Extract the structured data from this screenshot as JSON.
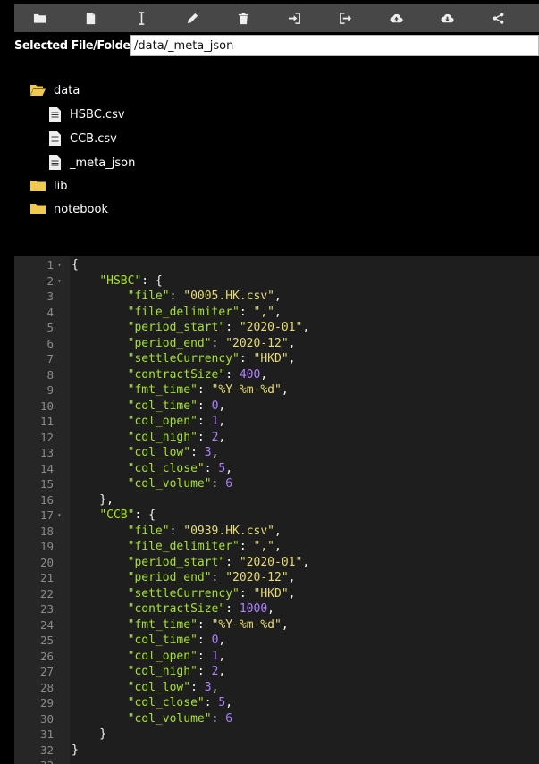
{
  "toolbar": {
    "buttons": [
      {
        "name": "open-folder-button",
        "icon": "folder-icon"
      },
      {
        "name": "new-file-button",
        "icon": "file-icon"
      },
      {
        "name": "rename-button",
        "icon": "text-cursor-icon"
      },
      {
        "name": "edit-button",
        "icon": "pencil-icon"
      },
      {
        "name": "delete-button",
        "icon": "trash-icon"
      },
      {
        "name": "sign-in-button",
        "icon": "sign-in-icon"
      },
      {
        "name": "sign-out-button",
        "icon": "sign-out-icon"
      },
      {
        "name": "upload-button",
        "icon": "cloud-upload-icon"
      },
      {
        "name": "download-button",
        "icon": "cloud-download-icon"
      },
      {
        "name": "share-button",
        "icon": "share-icon"
      }
    ],
    "background": "#474747"
  },
  "selection": {
    "label": "Selected File/Folder:",
    "value": "/data/_meta_json"
  },
  "tree": {
    "items": [
      {
        "label": "data",
        "type": "folder-open"
      },
      {
        "label": "HSBC.csv",
        "type": "file"
      },
      {
        "label": "CCB.csv",
        "type": "file"
      },
      {
        "label": "_meta_json",
        "type": "file"
      },
      {
        "label": "lib",
        "type": "folder"
      },
      {
        "label": "notebook",
        "type": "folder"
      }
    ],
    "folder_color": "#f0c94f"
  },
  "editor": {
    "lines": [
      {
        "n": "1",
        "fold": true,
        "t": [
          [
            "punc",
            "{"
          ]
        ]
      },
      {
        "n": "2",
        "fold": true,
        "t": [
          [
            "punc",
            "    "
          ],
          [
            "key",
            "\"HSBC\""
          ],
          [
            "punc",
            ": {"
          ]
        ]
      },
      {
        "n": "3",
        "t": [
          [
            "punc",
            "        "
          ],
          [
            "key",
            "\"file\""
          ],
          [
            "punc",
            ": "
          ],
          [
            "str",
            "\"0005.HK.csv\""
          ],
          [
            "punc",
            ","
          ]
        ]
      },
      {
        "n": "4",
        "t": [
          [
            "punc",
            "        "
          ],
          [
            "key",
            "\"file_delimiter\""
          ],
          [
            "punc",
            ": "
          ],
          [
            "str",
            "\",\""
          ],
          [
            "punc",
            ","
          ]
        ]
      },
      {
        "n": "5",
        "t": [
          [
            "punc",
            "        "
          ],
          [
            "key",
            "\"period_start\""
          ],
          [
            "punc",
            ": "
          ],
          [
            "str",
            "\"2020-01\""
          ],
          [
            "punc",
            ","
          ]
        ]
      },
      {
        "n": "6",
        "t": [
          [
            "punc",
            "        "
          ],
          [
            "key",
            "\"period_end\""
          ],
          [
            "punc",
            ": "
          ],
          [
            "str",
            "\"2020-12\""
          ],
          [
            "punc",
            ","
          ]
        ]
      },
      {
        "n": "7",
        "t": [
          [
            "punc",
            "        "
          ],
          [
            "key",
            "\"settleCurrency\""
          ],
          [
            "punc",
            ": "
          ],
          [
            "str",
            "\"HKD\""
          ],
          [
            "punc",
            ","
          ]
        ]
      },
      {
        "n": "8",
        "t": [
          [
            "punc",
            "        "
          ],
          [
            "key",
            "\"contractSize\""
          ],
          [
            "punc",
            ": "
          ],
          [
            "num",
            "400"
          ],
          [
            "punc",
            ","
          ]
        ]
      },
      {
        "n": "9",
        "t": [
          [
            "punc",
            "        "
          ],
          [
            "key",
            "\"fmt_time\""
          ],
          [
            "punc",
            ": "
          ],
          [
            "str",
            "\"%Y-%m-%d\""
          ],
          [
            "punc",
            ","
          ]
        ]
      },
      {
        "n": "10",
        "t": [
          [
            "punc",
            "        "
          ],
          [
            "key",
            "\"col_time\""
          ],
          [
            "punc",
            ": "
          ],
          [
            "num",
            "0"
          ],
          [
            "punc",
            ","
          ]
        ]
      },
      {
        "n": "11",
        "t": [
          [
            "punc",
            "        "
          ],
          [
            "key",
            "\"col_open\""
          ],
          [
            "punc",
            ": "
          ],
          [
            "num",
            "1"
          ],
          [
            "punc",
            ","
          ]
        ]
      },
      {
        "n": "12",
        "t": [
          [
            "punc",
            "        "
          ],
          [
            "key",
            "\"col_high\""
          ],
          [
            "punc",
            ": "
          ],
          [
            "num",
            "2"
          ],
          [
            "punc",
            ","
          ]
        ]
      },
      {
        "n": "13",
        "t": [
          [
            "punc",
            "        "
          ],
          [
            "key",
            "\"col_low\""
          ],
          [
            "punc",
            ": "
          ],
          [
            "num",
            "3"
          ],
          [
            "punc",
            ","
          ]
        ]
      },
      {
        "n": "14",
        "t": [
          [
            "punc",
            "        "
          ],
          [
            "key",
            "\"col_close\""
          ],
          [
            "punc",
            ": "
          ],
          [
            "num",
            "5"
          ],
          [
            "punc",
            ","
          ]
        ]
      },
      {
        "n": "15",
        "t": [
          [
            "punc",
            "        "
          ],
          [
            "key",
            "\"col_volume\""
          ],
          [
            "punc",
            ": "
          ],
          [
            "num",
            "6"
          ]
        ]
      },
      {
        "n": "16",
        "t": [
          [
            "punc",
            "    },"
          ]
        ]
      },
      {
        "n": "17",
        "fold": true,
        "t": [
          [
            "punc",
            "    "
          ],
          [
            "key",
            "\"CCB\""
          ],
          [
            "punc",
            ": {"
          ]
        ]
      },
      {
        "n": "18",
        "t": [
          [
            "punc",
            "        "
          ],
          [
            "key",
            "\"file\""
          ],
          [
            "punc",
            ": "
          ],
          [
            "str",
            "\"0939.HK.csv\""
          ],
          [
            "punc",
            ","
          ]
        ]
      },
      {
        "n": "19",
        "t": [
          [
            "punc",
            "        "
          ],
          [
            "key",
            "\"file_delimiter\""
          ],
          [
            "punc",
            ": "
          ],
          [
            "str",
            "\",\""
          ],
          [
            "punc",
            ","
          ]
        ]
      },
      {
        "n": "20",
        "t": [
          [
            "punc",
            "        "
          ],
          [
            "key",
            "\"period_start\""
          ],
          [
            "punc",
            ": "
          ],
          [
            "str",
            "\"2020-01\""
          ],
          [
            "punc",
            ","
          ]
        ]
      },
      {
        "n": "21",
        "t": [
          [
            "punc",
            "        "
          ],
          [
            "key",
            "\"period_end\""
          ],
          [
            "punc",
            ": "
          ],
          [
            "str",
            "\"2020-12\""
          ],
          [
            "punc",
            ","
          ]
        ]
      },
      {
        "n": "22",
        "t": [
          [
            "punc",
            "        "
          ],
          [
            "key",
            "\"settleCurrency\""
          ],
          [
            "punc",
            ": "
          ],
          [
            "str",
            "\"HKD\""
          ],
          [
            "punc",
            ","
          ]
        ]
      },
      {
        "n": "23",
        "t": [
          [
            "punc",
            "        "
          ],
          [
            "key",
            "\"contractSize\""
          ],
          [
            "punc",
            ": "
          ],
          [
            "num",
            "1000"
          ],
          [
            "punc",
            ","
          ]
        ]
      },
      {
        "n": "24",
        "t": [
          [
            "punc",
            "        "
          ],
          [
            "key",
            "\"fmt_time\""
          ],
          [
            "punc",
            ": "
          ],
          [
            "str",
            "\"%Y-%m-%d\""
          ],
          [
            "punc",
            ","
          ]
        ]
      },
      {
        "n": "25",
        "t": [
          [
            "punc",
            "        "
          ],
          [
            "key",
            "\"col_time\""
          ],
          [
            "punc",
            ": "
          ],
          [
            "num",
            "0"
          ],
          [
            "punc",
            ","
          ]
        ]
      },
      {
        "n": "26",
        "t": [
          [
            "punc",
            "        "
          ],
          [
            "key",
            "\"col_open\""
          ],
          [
            "punc",
            ": "
          ],
          [
            "num",
            "1"
          ],
          [
            "punc",
            ","
          ]
        ]
      },
      {
        "n": "27",
        "t": [
          [
            "punc",
            "        "
          ],
          [
            "key",
            "\"col_high\""
          ],
          [
            "punc",
            ": "
          ],
          [
            "num",
            "2"
          ],
          [
            "punc",
            ","
          ]
        ]
      },
      {
        "n": "28",
        "t": [
          [
            "punc",
            "        "
          ],
          [
            "key",
            "\"col_low\""
          ],
          [
            "punc",
            ": "
          ],
          [
            "num",
            "3"
          ],
          [
            "punc",
            ","
          ]
        ]
      },
      {
        "n": "29",
        "t": [
          [
            "punc",
            "        "
          ],
          [
            "key",
            "\"col_close\""
          ],
          [
            "punc",
            ": "
          ],
          [
            "num",
            "5"
          ],
          [
            "punc",
            ","
          ]
        ]
      },
      {
        "n": "30",
        "t": [
          [
            "punc",
            "        "
          ],
          [
            "key",
            "\"col_volume\""
          ],
          [
            "punc",
            ": "
          ],
          [
            "num",
            "6"
          ]
        ]
      },
      {
        "n": "31",
        "t": [
          [
            "punc",
            "    }"
          ]
        ]
      },
      {
        "n": "32",
        "t": [
          [
            "punc",
            "}"
          ]
        ]
      },
      {
        "n": "33",
        "t": []
      }
    ]
  }
}
